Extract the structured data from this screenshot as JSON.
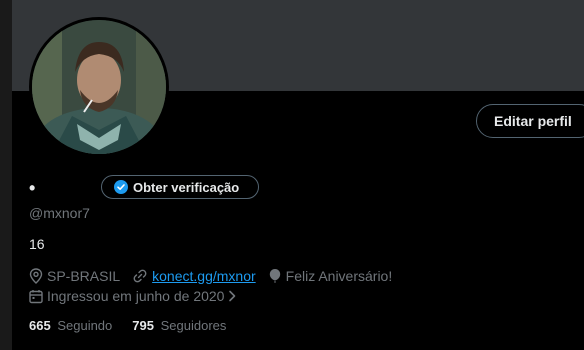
{
  "profile": {
    "display_name": "•",
    "handle": "@mxnor7",
    "bio": "16",
    "location": "SP-BRASIL",
    "website": "konect.gg/mxnor",
    "birthday": "Feliz Aniversário!",
    "joined": "Ingressou em junho de 2020",
    "following_count": "665",
    "following_label": "Seguindo",
    "followers_count": "795",
    "followers_label": "Seguidores"
  },
  "buttons": {
    "edit_profile": "Editar perfil",
    "get_verified": "Obter verificação"
  },
  "colors": {
    "background": "#000000",
    "banner": "#333639",
    "link": "#1d9bf0",
    "muted": "#71767b",
    "verified_badge": "#1d9bf0"
  },
  "icons": {
    "verified": "verified-badge-icon",
    "location": "location-pin-icon",
    "website": "link-icon",
    "birthday": "balloon-icon",
    "joined": "calendar-icon",
    "expand": "chevron-right-icon"
  }
}
